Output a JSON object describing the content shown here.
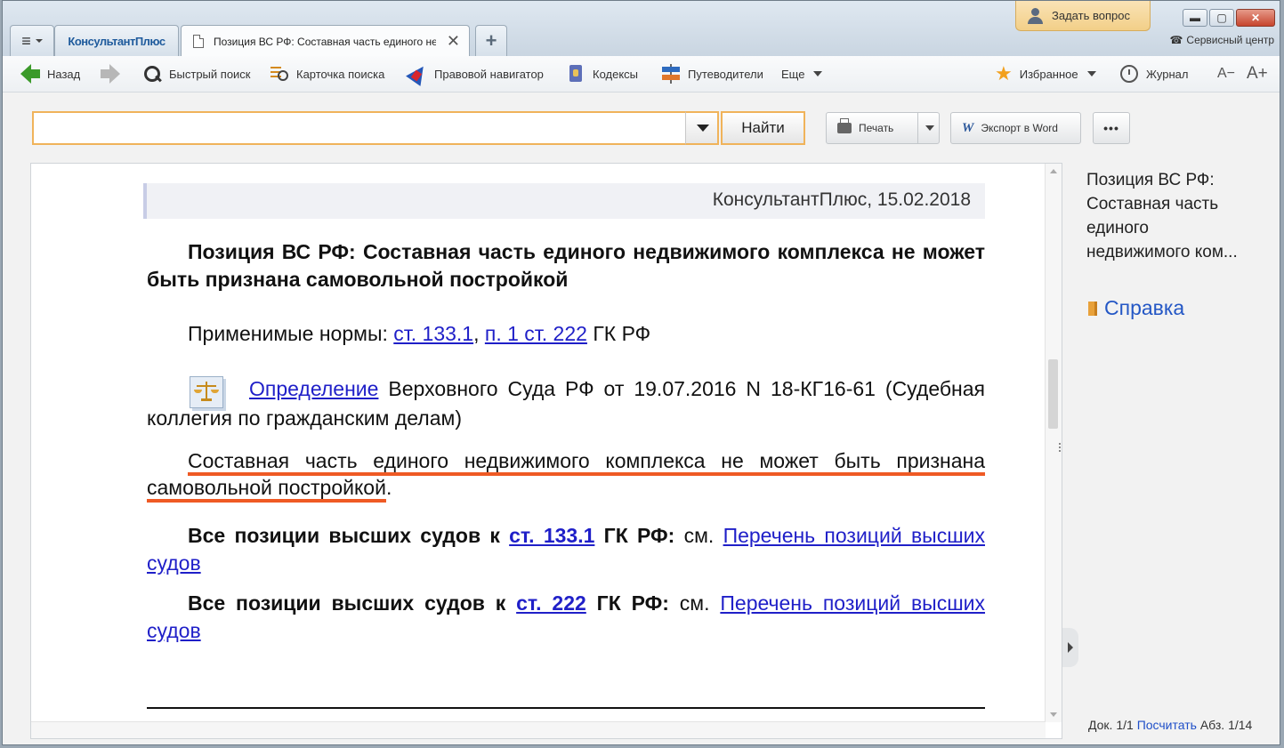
{
  "window": {
    "tabs": {
      "menu_label": "≡",
      "logo": "КонсультантПлюс",
      "doc_tab_title": "Позиция ВС РФ: Составная часть единого недвижимого комплекса",
      "close": "✕",
      "add": "+"
    },
    "ask_question": "Задать вопрос",
    "service_center": "Сервисный центр",
    "controls": {
      "minimize": "▬",
      "maximize": "▢",
      "close": "✕"
    }
  },
  "toolbar": {
    "back": "Назад",
    "quick_search": "Быстрый поиск",
    "search_card": "Карточка поиска",
    "legal_navigator": "Правовой навигатор",
    "codes": "Кодексы",
    "guides": "Путеводители",
    "more": "Еще",
    "favorites": "Избранное",
    "journal": "Журнал",
    "font_smaller": "A−",
    "font_larger": "A+"
  },
  "search": {
    "value": "",
    "placeholder": "",
    "find_button": "Найти"
  },
  "actions": {
    "print": "Печать",
    "export_word": "Экспорт в Word",
    "more": "•••"
  },
  "document": {
    "header": "КонсультантПлюс, 15.02.2018",
    "title": "Позиция ВС РФ: Составная часть единого недвижимого комплекса не может быть признана самовольной постройкой",
    "norms_prefix": "Применимые нормы: ",
    "norm_link_1": "ст. 133.1",
    "norms_sep": ", ",
    "norm_link_2": "п. 1 ст. 222",
    "norms_suffix": " ГК РФ",
    "definition_link": "Определение",
    "definition_text": " Верховного Суда РФ от 19.07.2016 N 18-КГ16-61 (Судебная коллегия по гражданским делам)",
    "main_text": "Составная часть единого недвижимого комплекса не может быть признана самовольной постройкой",
    "main_dot": ".",
    "all1_bold": "Все позиции высших судов к ",
    "all1_link": "ст. 133.1",
    "all1_bold2": " ГК РФ:",
    "all1_see": " см. ",
    "all1_list_link": "Перечень позиций высших судов",
    "all2_bold": "Все позиции высших судов к ",
    "all2_link": "ст. 222",
    "all2_bold2": " ГК РФ:",
    "all2_see": " см. ",
    "all2_list_link": "Перечень позиций высших судов"
  },
  "right_panel": {
    "title_line1": "Позиция ВС РФ:",
    "title_line2": "Составная часть",
    "title_line3": "единого",
    "title_line4": "недвижимого ком...",
    "help": "Справка",
    "status_doc": "Док. 1/1",
    "status_count": "Посчитать",
    "status_par": "Абз. 1/14"
  },
  "colors": {
    "accent_orange": "#f0b35a",
    "link_blue": "#1f1fc8",
    "underline_highlight": "#ef5a24"
  }
}
